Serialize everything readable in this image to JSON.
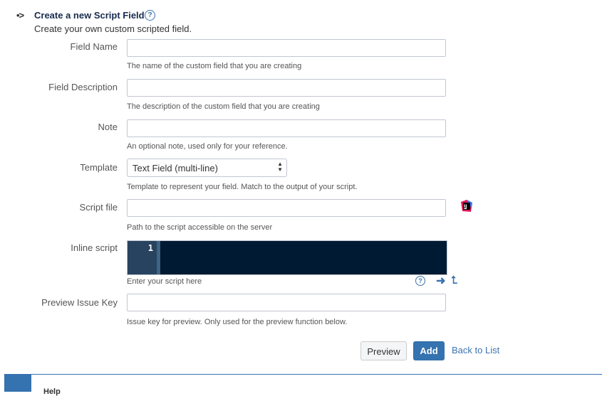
{
  "header": {
    "bullet": "•>",
    "title": "Create a new Script Field",
    "help_glyph": "?",
    "subtitle": "Create your own custom scripted field."
  },
  "form": {
    "field_name": {
      "label": "Field Name",
      "value": "",
      "hint": "The name of the custom field that you are creating"
    },
    "field_description": {
      "label": "Field Description",
      "value": "",
      "hint": "The description of the custom field that you are creating"
    },
    "note": {
      "label": "Note",
      "value": "",
      "hint": "An optional note, used only for your reference."
    },
    "template": {
      "label": "Template",
      "selected": "Text Field (multi-line)",
      "hint": "Template to represent your field. Match to the output of your script."
    },
    "script_file": {
      "label": "Script file",
      "value": "",
      "hint": "Path to the script accessible on the server",
      "ide_icon": "intellij-icon",
      "ide_icon_text": "IJ"
    },
    "inline_script": {
      "label": "Inline script",
      "line_number": "1",
      "hint": "Enter your script here",
      "help_glyph": "?",
      "arrow_glyph": "➜",
      "up_glyph": "⮤"
    },
    "preview_issue_key": {
      "label": "Preview Issue Key",
      "value": "",
      "hint": "Issue key for preview. Only used for the preview function below."
    }
  },
  "actions": {
    "preview_label": "Preview",
    "add_label": "Add",
    "back_label": "Back to List"
  },
  "footer": {
    "partial_text": "Help"
  },
  "colors": {
    "accent": "#3572b0",
    "link": "#3b73af",
    "editor_bg": "#001a33",
    "gutter_bg": "#27435f"
  }
}
